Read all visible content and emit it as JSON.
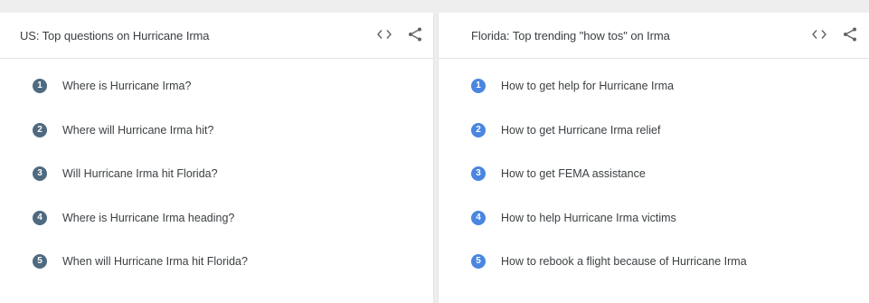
{
  "colors": {
    "left_badge": "#4f6a80",
    "right_badge": "#4a86e0",
    "icon": "#5f6368"
  },
  "left_card": {
    "title": "US: Top questions on Hurricane Irma",
    "embed_icon": "code-icon",
    "share_icon": "share-icon",
    "items": [
      {
        "num": "1",
        "text": "Where is Hurricane Irma?"
      },
      {
        "num": "2",
        "text": "Where will Hurricane Irma hit?"
      },
      {
        "num": "3",
        "text": "Will Hurricane Irma hit Florida?"
      },
      {
        "num": "4",
        "text": "Where is Hurricane Irma heading?"
      },
      {
        "num": "5",
        "text": "When will Hurricane Irma hit Florida?"
      }
    ]
  },
  "right_card": {
    "title": "Florida: Top trending \"how tos\" on Irma",
    "embed_icon": "code-icon",
    "share_icon": "share-icon",
    "items": [
      {
        "num": "1",
        "text": "How to get help for Hurricane Irma"
      },
      {
        "num": "2",
        "text": "How to get Hurricane Irma relief"
      },
      {
        "num": "3",
        "text": "How to get FEMA assistance"
      },
      {
        "num": "4",
        "text": "How to help Hurricane Irma victims"
      },
      {
        "num": "5",
        "text": "How to rebook a flight because of Hurricane Irma"
      }
    ]
  }
}
